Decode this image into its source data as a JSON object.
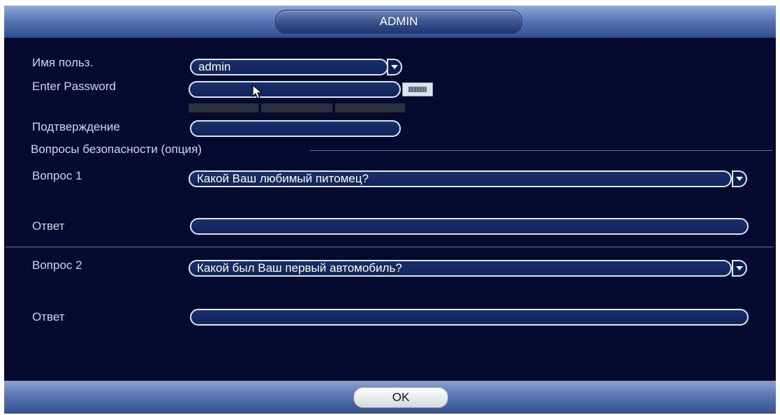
{
  "dialog": {
    "title": "ADMIN"
  },
  "form": {
    "username_label": "Имя польз.",
    "username_value": "admin",
    "password_label": "Enter Password",
    "password_value": "",
    "confirm_label": "Подтверждение",
    "confirm_value": "",
    "security_section_title": "Вопросы безопасности (опция)",
    "question1_label": "Вопрос 1",
    "question1_value": "Какой Ваш любимый питомец?",
    "answer1_label": "Ответ",
    "answer1_value": "",
    "question2_label": "Вопрос 2",
    "question2_value": "Какой был Ваш первый автомобиль?",
    "answer2_label": "Ответ",
    "answer2_value": ""
  },
  "footer": {
    "ok_label": "OK"
  },
  "colors": {
    "background": "#050a2e",
    "bar": "#5a78b8",
    "field_border": "#dfe7f5",
    "label": "#c8d6ee"
  },
  "icons": {
    "dropdown": "chevron-down-icon",
    "keyboard": "keyboard-icon",
    "cursor": "mouse-cursor-icon"
  }
}
